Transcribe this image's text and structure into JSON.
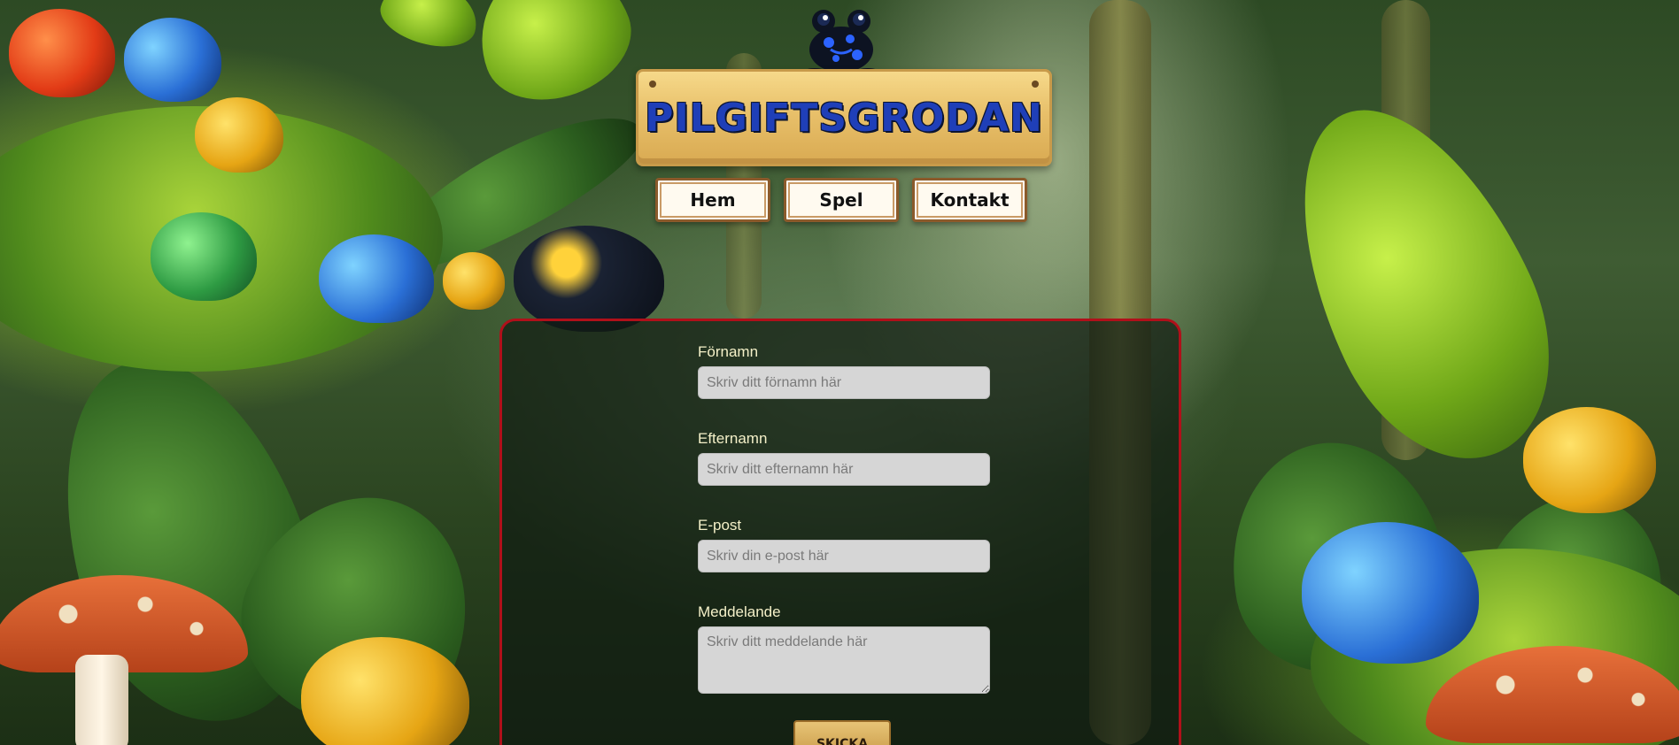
{
  "site": {
    "title": "PILGIFTSGRODAN"
  },
  "nav": {
    "items": [
      {
        "label": "Hem"
      },
      {
        "label": "Spel"
      },
      {
        "label": "Kontakt"
      }
    ]
  },
  "form": {
    "first_name": {
      "label": "Förnamn",
      "placeholder": "Skriv ditt förnamn här",
      "value": ""
    },
    "last_name": {
      "label": "Efternamn",
      "placeholder": "Skriv ditt efternamn här",
      "value": ""
    },
    "email": {
      "label": "E-post",
      "placeholder": "Skriv din e-post här",
      "value": ""
    },
    "message": {
      "label": "Meddelande",
      "placeholder": "Skriv ditt meddelande här",
      "value": ""
    },
    "submit_label": "SKICKA"
  },
  "colors": {
    "panel_border": "#b0101a",
    "label_text": "#f4f0c8",
    "logo_text": "#1f3fb8",
    "nav_border": "#8b5a2b"
  },
  "icons": {
    "logo": "poison-dart-frog-icon"
  }
}
